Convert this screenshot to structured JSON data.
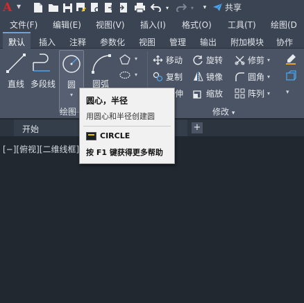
{
  "quick_access": {
    "logo": "A",
    "share_label": "共享",
    "icons": [
      "new-file-icon",
      "open-folder-icon",
      "save-icon",
      "save-as-icon",
      "print-preview-icon",
      "export-icon",
      "import-icon",
      "print-icon",
      "undo-icon",
      "redo-icon",
      "customize-icon",
      "share-icon"
    ]
  },
  "menubar": {
    "items": [
      "文件(F)",
      "编辑(E)",
      "视图(V)",
      "插入(I)",
      "格式(O)",
      "工具(T)",
      "绘图(D"
    ]
  },
  "ribbon_tabs": [
    "默认",
    "插入",
    "注释",
    "参数化",
    "视图",
    "管理",
    "输出",
    "附加模块",
    "协作"
  ],
  "draw_panel": {
    "title": "绘图",
    "buttons": {
      "line": "直线",
      "polyline": "多段线",
      "circle": "圆",
      "arc": "圆弧"
    }
  },
  "modify_panel": {
    "title": "修改",
    "row1": [
      "移动",
      "旋转",
      "修剪"
    ],
    "row2": [
      "复制",
      "镜像",
      "圆角"
    ],
    "row3": [
      "伸",
      "缩放",
      "阵列"
    ]
  },
  "document_tabs": {
    "start": "开始"
  },
  "viewport": {
    "label": "[−][俯视][二维线框]"
  },
  "tooltip": {
    "title": "圆心，半径",
    "description": "用圆心和半径创建圆",
    "command": "CIRCLE",
    "help": "按 F1 键获得更多帮助"
  },
  "colors": {
    "accent": "#6fa3d8",
    "logo_red": "#d42a2a",
    "ribbon": "#4a5465",
    "background": "#212830"
  }
}
